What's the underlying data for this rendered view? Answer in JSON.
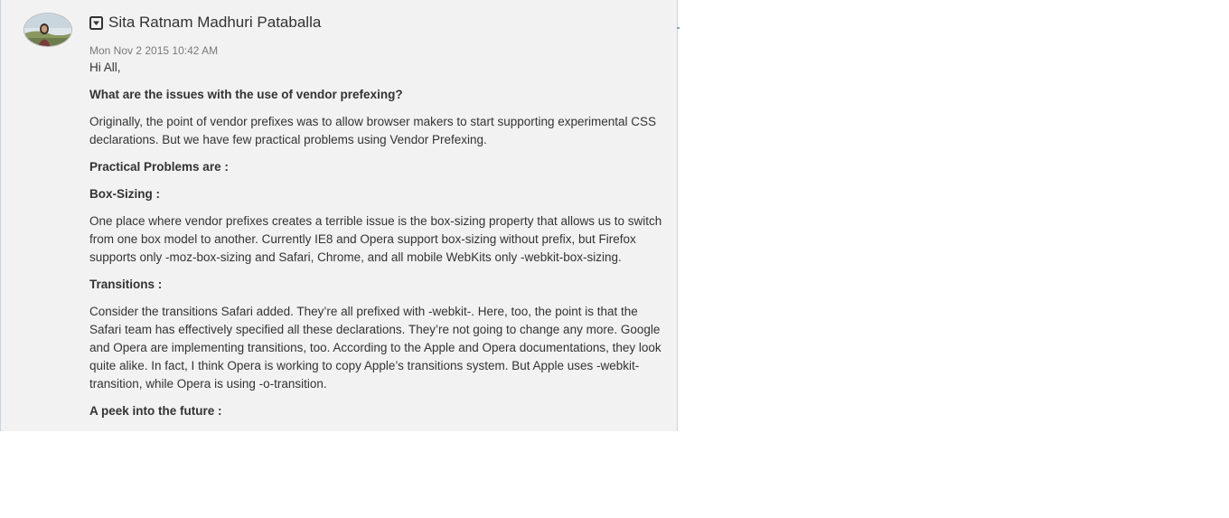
{
  "post": {
    "author": "Sita Ratnam Madhuri Pataballa",
    "timestamp": "Mon Nov 2 2015 10:42 AM",
    "paragraphs": [
      {
        "text": "Hi All,",
        "bold": false
      },
      {
        "text": "What are the issues with the use of vendor prefexing?",
        "bold": true
      },
      {
        "text": "Originally, the point of vendor prefixes was to allow browser makers to start supporting experimental CSS declarations. But we have few practical problems using Vendor Prefexing.",
        "bold": false
      },
      {
        "text": "Practical Problems are :",
        "bold": true
      },
      {
        "text": "Box-Sizing :",
        "bold": true
      },
      {
        "text": "One place where vendor prefixes creates a terrible issue is the box-sizing property that allows us to switch from one box model to another. Currently IE8 and Opera support box-sizing without prefix, but Firefox supports only -moz-box-sizing and Safari, Chrome, and all mobile WebKits only -webkit-box-sizing.",
        "bold": false
      },
      {
        "text": " Transitions :",
        "bold": true
      },
      {
        "text": "Consider the transitions Safari added. They’re all prefixed with -webkit-. Here, too, the point is that the Safari team has effectively specified all these declarations. They’re not going to change any more. Google and Opera are implementing transitions, too. According to the Apple and Opera documentations, they look quite alike. In fact, I think Opera is working to copy Apple’s transitions system. But Apple uses -webkit-transition, while Opera is using -o-transition.",
        "bold": false
      },
      {
        "text": "A peek into the future :",
        "bold": true
      }
    ]
  },
  "icons": {
    "menu": "dropdown-menu-icon",
    "avatar": "user-avatar"
  }
}
